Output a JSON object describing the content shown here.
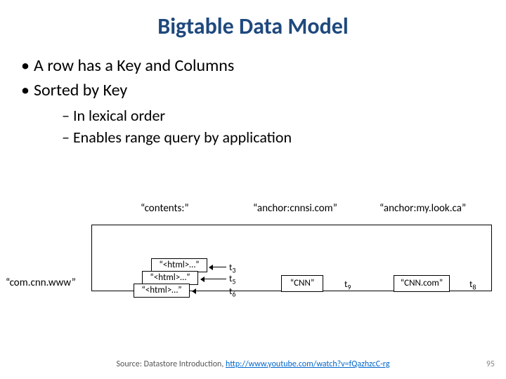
{
  "title": "Bigtable Data Model",
  "bullets": [
    "A row has a Key and Columns",
    "Sorted by Key"
  ],
  "subbullets": [
    "In lexical order",
    "Enables range query by application"
  ],
  "columns": {
    "c1": "“contents:”",
    "c2": "“anchor:cnnsi.com”",
    "c3": "“anchor:my.look.ca”"
  },
  "row_key": "“com.cnn.www”",
  "cells": {
    "contents_v1": "“<html>…”",
    "contents_v2": "“<html>…”",
    "contents_v3": "“<html>…”",
    "anchor1": "“CNN”",
    "anchor2": "“CNN.com”"
  },
  "timestamps": {
    "t3": "3",
    "t5": "5",
    "t6": "6",
    "t9": "9",
    "t8": "8"
  },
  "footer_prefix": "Source: Datastore Introduction, ",
  "footer_link": "http://www.youtube.com/watch?v=fQazhzcC-rg",
  "page_number": "95"
}
